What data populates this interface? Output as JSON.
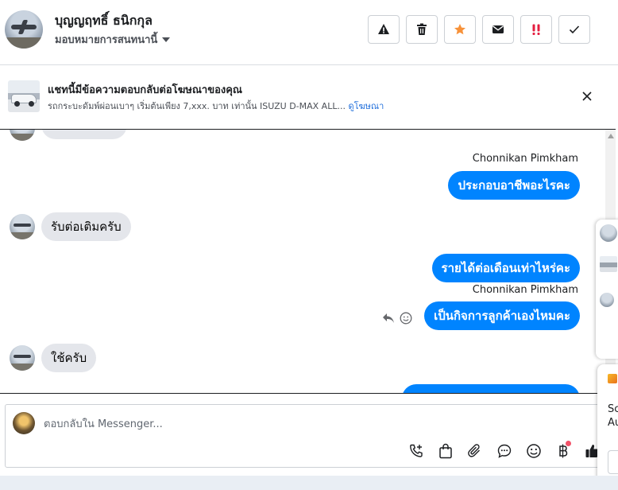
{
  "header": {
    "contact_name": "บุญญฤทธิ์ ธนิกกุล",
    "assignment_label": "มอบหมายการสนทนานี้",
    "action_icons": [
      "warning-icon",
      "trash-icon",
      "star-icon",
      "mail-icon",
      "priority-icon",
      "check-icon"
    ],
    "star_color": "#f7923a",
    "priority_color": "#e41e3f"
  },
  "ad_banner": {
    "title": "แชทนี้มีข้อความตอบกลับต่อโฆษณาของคุณ",
    "description": "รถกระบะดัมพ์ผ่อนเบาๆ เริ่มต้นเพียง 7,xxx. บาท เท่านั้น ISUZU D-MAX ALL...",
    "link_text": "ดูโฆษณา"
  },
  "messages": [
    {
      "direction": "incoming",
      "text": ""
    },
    {
      "direction": "outgoing",
      "sender": "Chonnikan Pimkham",
      "text": "ประกอบอาชีพอะไรคะ"
    },
    {
      "direction": "incoming",
      "text": "รับต่อเติมครับ"
    },
    {
      "direction": "outgoing",
      "text": "รายได้ต่อเดือนเท่าไหร่คะ"
    },
    {
      "direction": "outgoing",
      "sender": "Chonnikan Pimkham",
      "text": "เป็นกิจการลูกค้าเองไหมคะ"
    },
    {
      "direction": "incoming",
      "text": "ใช้ครับ"
    },
    {
      "direction": "outgoing",
      "text": ""
    }
  ],
  "composer": {
    "placeholder": "ตอบกลับใน Messenger...",
    "tool_icons": [
      "phone-plus-icon",
      "shopping-bag-icon",
      "paperclip-icon",
      "saved-reply-icon",
      "emoji-icon",
      "baht-icon",
      "like-icon"
    ],
    "accent": "#0084ff"
  },
  "side_toast": {
    "text_line1": "Sc",
    "text_line2": "Au"
  },
  "colors": {
    "bubble_out": "#0084ff",
    "bubble_in": "#e4e6eb",
    "link": "#216fdb"
  }
}
